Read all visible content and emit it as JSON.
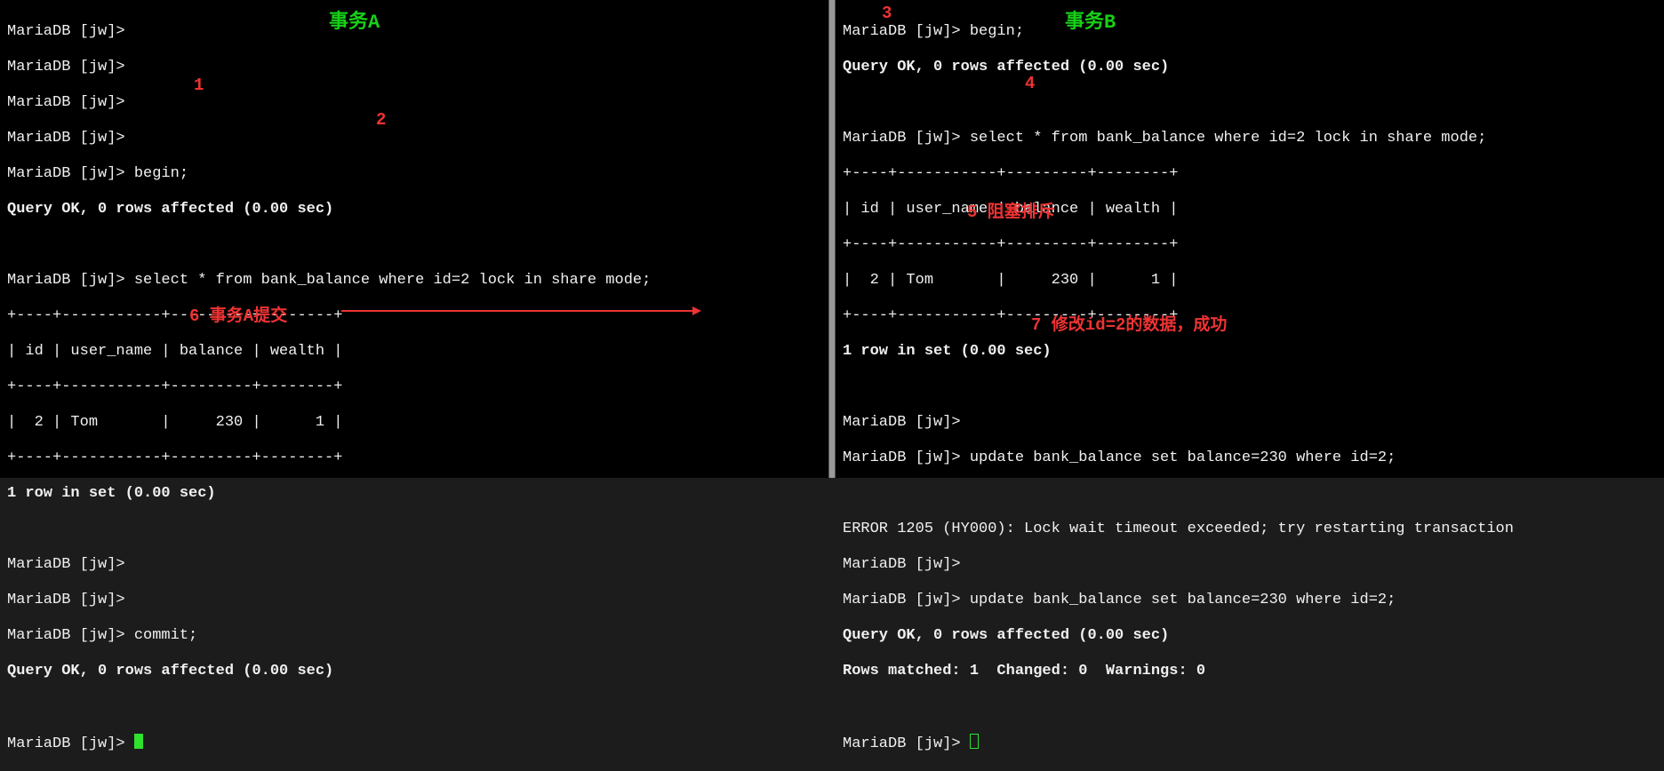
{
  "titles": {
    "transA": "事务A",
    "transB": "事务B"
  },
  "annotations": {
    "n1": "1",
    "n2": "2",
    "n3": "3",
    "n4": "4",
    "n5": "5 阻塞排斥",
    "n6": "6 事务A提交",
    "n7": "7 修改id=2的数据，成功"
  },
  "paneA": {
    "p1": "MariaDB [jw]>",
    "p2": "MariaDB [jw]>",
    "p3": "MariaDB [jw]>",
    "p4": "MariaDB [jw]>",
    "begin": "MariaDB [jw]> begin;",
    "ok1": "Query OK, 0 rows affected (0.00 sec)",
    "blank1": "",
    "select": "MariaDB [jw]> select * from bank_balance where id=2 lock in share mode;",
    "t_top": "+----+-----------+---------+--------+",
    "t_head": "| id | user_name | balance | wealth |",
    "t_mid": "+----+-----------+---------+--------+",
    "t_row": "|  2 | Tom       |     230 |      1 |",
    "t_bot": "+----+-----------+---------+--------+",
    "rows": "1 row in set (0.00 sec)",
    "blank2": "",
    "p5": "MariaDB [jw]>",
    "p6": "MariaDB [jw]>",
    "commit": "MariaDB [jw]> commit;",
    "ok2": "Query OK, 0 rows affected (0.00 sec)",
    "blank3": "",
    "last": "MariaDB [jw]> "
  },
  "paneB": {
    "begin": "MariaDB [jw]> begin;",
    "ok1": "Query OK, 0 rows affected (0.00 sec)",
    "blank1": "",
    "select": "MariaDB [jw]> select * from bank_balance where id=2 lock in share mode;",
    "t_top": "+----+-----------+---------+--------+",
    "t_head": "| id | user_name | balance | wealth |",
    "t_mid": "+----+-----------+---------+--------+",
    "t_row": "|  2 | Tom       |     230 |      1 |",
    "t_bot": "+----+-----------+---------+--------+",
    "rows": "1 row in set (0.00 sec)",
    "blank2": "",
    "p1": "MariaDB [jw]>",
    "update1": "MariaDB [jw]> update bank_balance set balance=230 where id=2;",
    "blank3": "",
    "err": "ERROR 1205 (HY000): Lock wait timeout exceeded; try restarting transaction",
    "p2": "MariaDB [jw]>",
    "update2": "MariaDB [jw]> update bank_balance set balance=230 where id=2;",
    "ok2": "Query OK, 0 rows affected (0.00 sec)",
    "matched": "Rows matched: 1  Changed: 0  Warnings: 0",
    "blank4": "",
    "last": "MariaDB [jw]> "
  }
}
